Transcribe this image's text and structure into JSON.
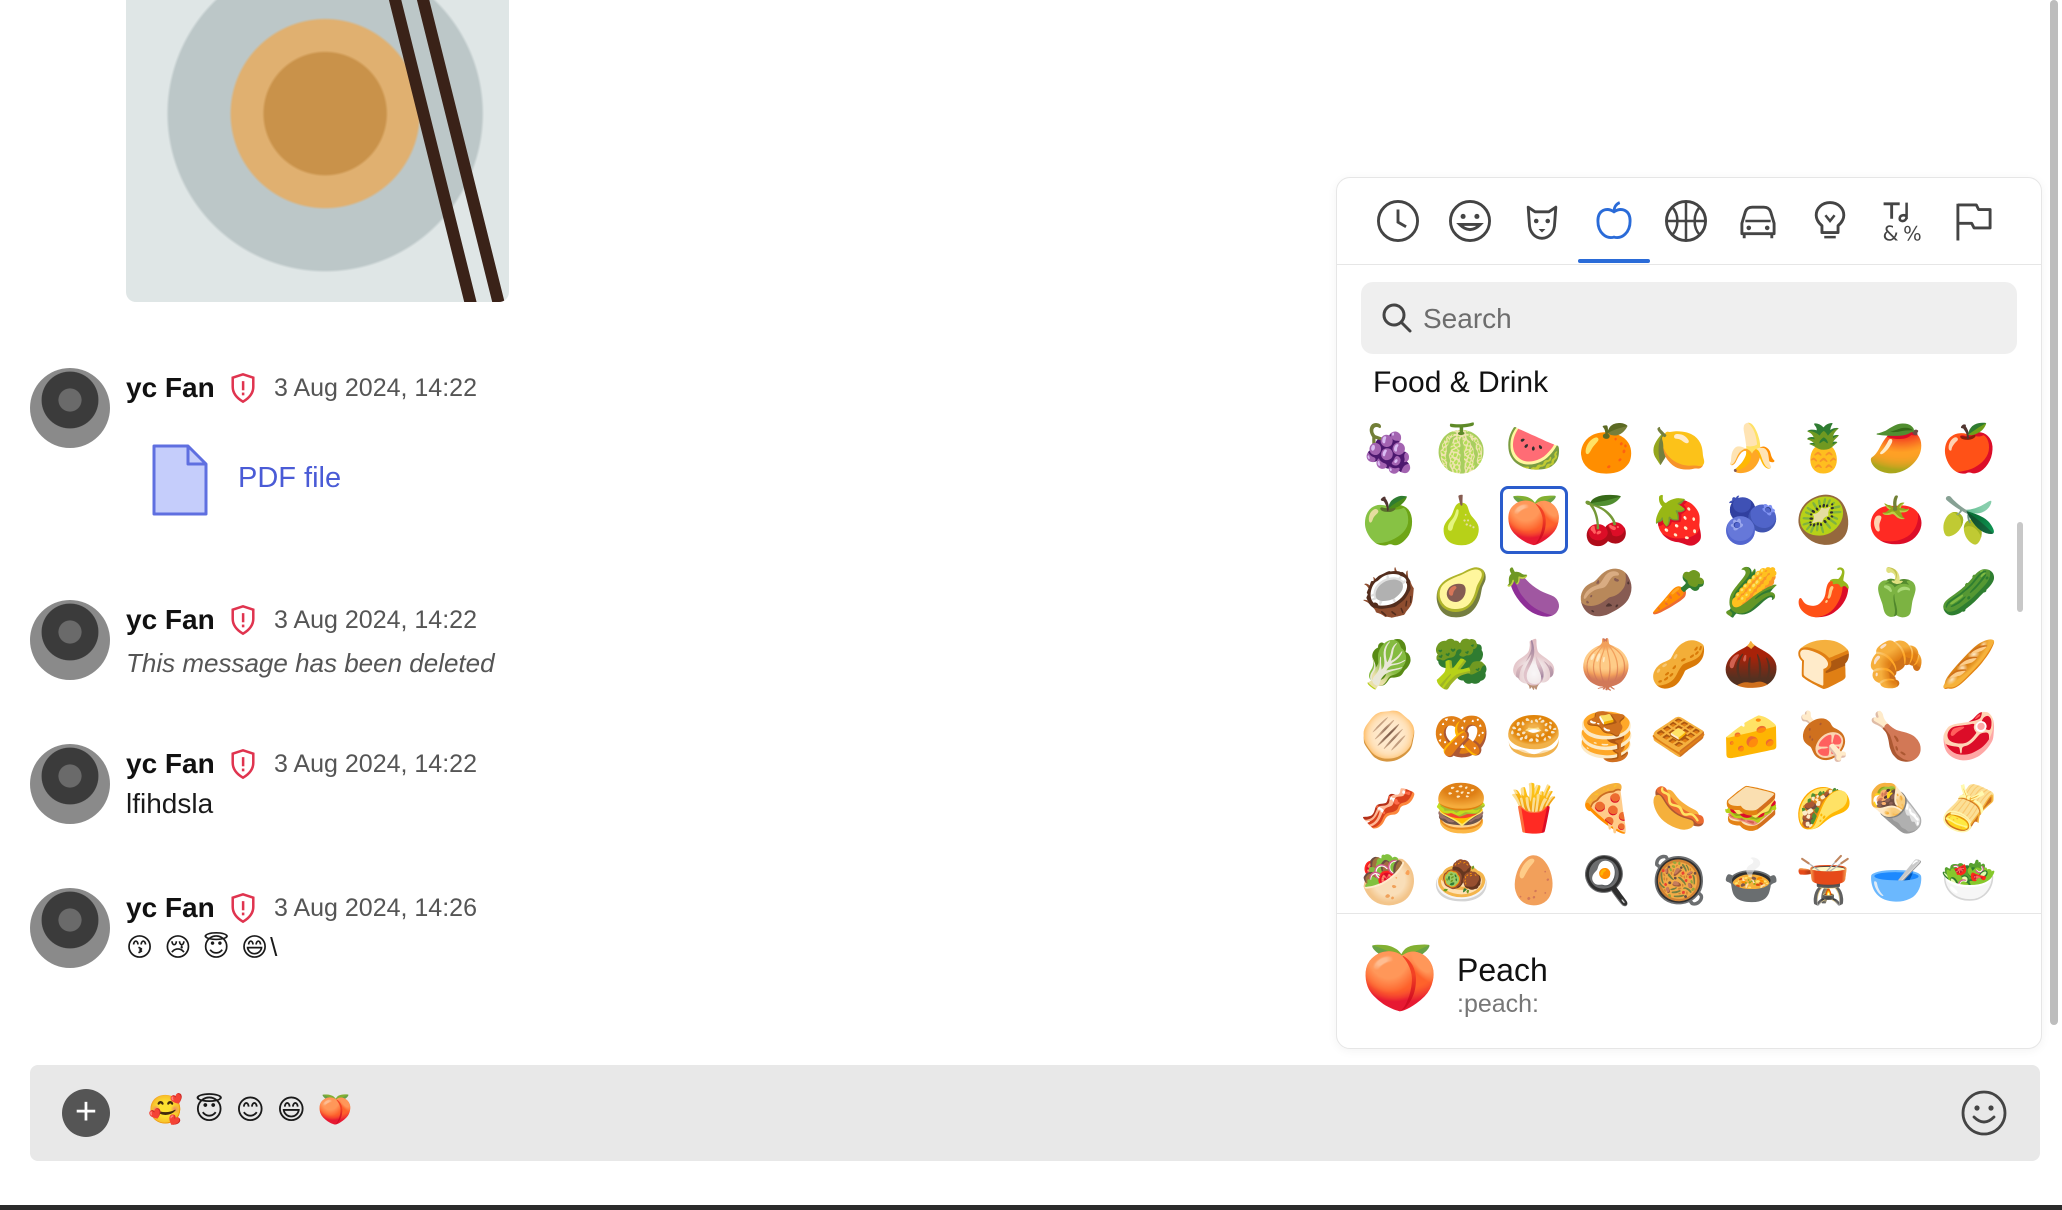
{
  "messages": [
    {
      "author": "yc Fan",
      "time": "3 Aug 2024, 14:22",
      "kind": "file",
      "file_label": "PDF file"
    },
    {
      "author": "yc Fan",
      "time": "3 Aug 2024, 14:22",
      "kind": "deleted",
      "text": "This message has been deleted"
    },
    {
      "author": "yc Fan",
      "time": "3 Aug 2024, 14:22",
      "kind": "text",
      "text": "lfihdsla"
    },
    {
      "author": "yc Fan",
      "time": "3 Aug 2024, 14:26",
      "kind": "text",
      "text": "😙 😢 😇 😄\\"
    }
  ],
  "composer": {
    "text": "🥰 😇 😊 😄 🍑"
  },
  "picker": {
    "tabs": [
      "recent-icon",
      "smileys-icon",
      "animals-icon",
      "food-icon",
      "activity-icon",
      "travel-icon",
      "objects-icon",
      "symbols-icon",
      "flags-icon"
    ],
    "active_tab": 3,
    "search_placeholder": "Search",
    "category_title": "Food & Drink",
    "emojis": [
      [
        "🍇",
        "🍈",
        "🍉",
        "🍊",
        "🍋",
        "🍌",
        "🍍",
        "🥭",
        "🍎"
      ],
      [
        "🍏",
        "🍐",
        "🍑",
        "🍒",
        "🍓",
        "🫐",
        "🥝",
        "🍅",
        "🫒"
      ],
      [
        "🥥",
        "🥑",
        "🍆",
        "🥔",
        "🥕",
        "🌽",
        "🌶️",
        "🫑",
        "🥒"
      ],
      [
        "🥬",
        "🥦",
        "🧄",
        "🧅",
        "🥜",
        "🌰",
        "🍞",
        "🥐",
        "🥖"
      ],
      [
        "🫓",
        "🥨",
        "🥯",
        "🥞",
        "🧇",
        "🧀",
        "🍖",
        "🍗",
        "🥩"
      ],
      [
        "🥓",
        "🍔",
        "🍟",
        "🍕",
        "🌭",
        "🥪",
        "🌮",
        "🌯",
        "🫔"
      ],
      [
        "🥙",
        "🧆",
        "🥚",
        "🍳",
        "🥘",
        "🍲",
        "🫕",
        "🥣",
        "🥗"
      ]
    ],
    "selected": {
      "row": 1,
      "col": 2
    },
    "preview": {
      "emoji": "🍑",
      "name": "Peach",
      "shortcode": ":peach:"
    }
  }
}
